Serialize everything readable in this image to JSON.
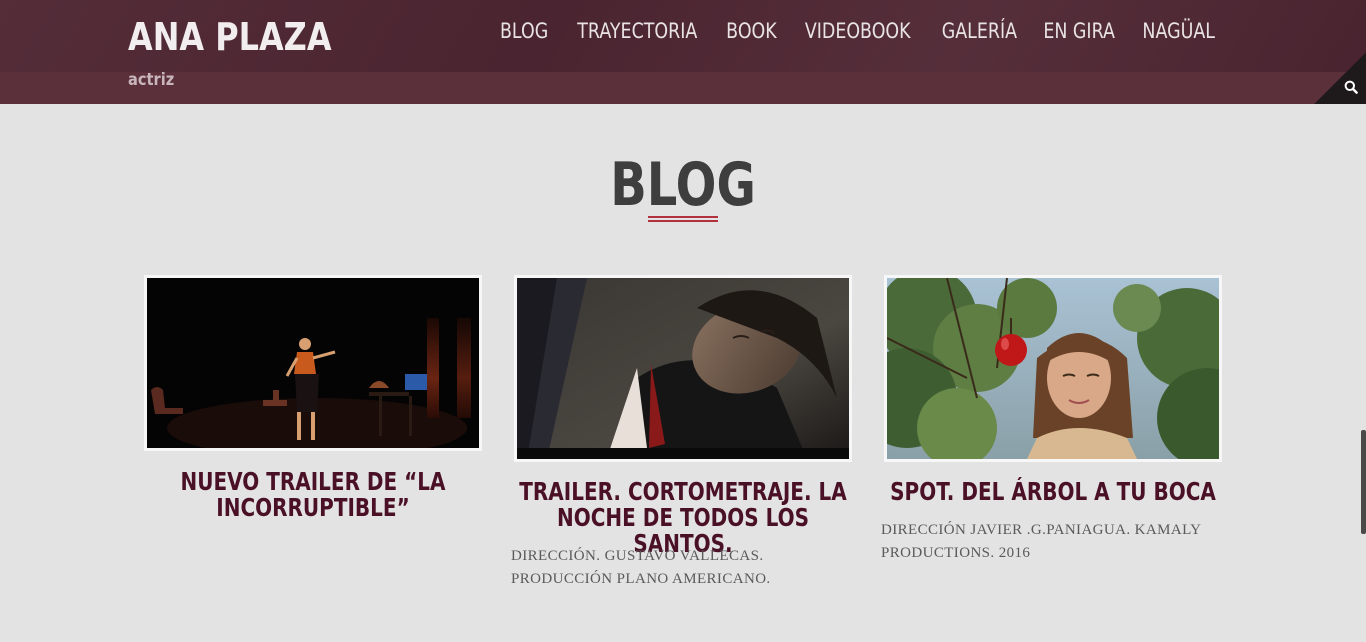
{
  "header": {
    "site_title": "ANA PLAZA",
    "tagline": "actriz",
    "nav": [
      "BLOG",
      "TRAYECTORIA",
      "BOOK",
      "VIDEOBOOK",
      "GALERÍA",
      "EN GIRA",
      "NAGÜAL"
    ],
    "search_icon": "search-icon"
  },
  "main": {
    "section_title": "BLOG",
    "posts": [
      {
        "title": "NUEVO TRAILER DE “LA INCORRUPTIBLE”",
        "excerpt": ""
      },
      {
        "title": "TRAILER. CORTOMETRAJE. LA NOCHE DE TODOS LOS SANTOS.",
        "excerpt": "DIRECCIÓN. GUSTAVO VALLECAS. PRODUCCIÓN PLANO AMERICANO."
      },
      {
        "title": "SPOT. DEL ÁRBOL A TU BOCA",
        "excerpt": "DIRECCIÓN JAVIER .G.PANIAGUA. KAMALY PRODUCTIONS. 2016"
      }
    ]
  },
  "colors": {
    "header_bg": "#4e2632",
    "header_strip": "#5b303b",
    "page_bg": "#e3e3e3",
    "post_title": "#4a1026",
    "accent_underline": "#b2313f"
  }
}
